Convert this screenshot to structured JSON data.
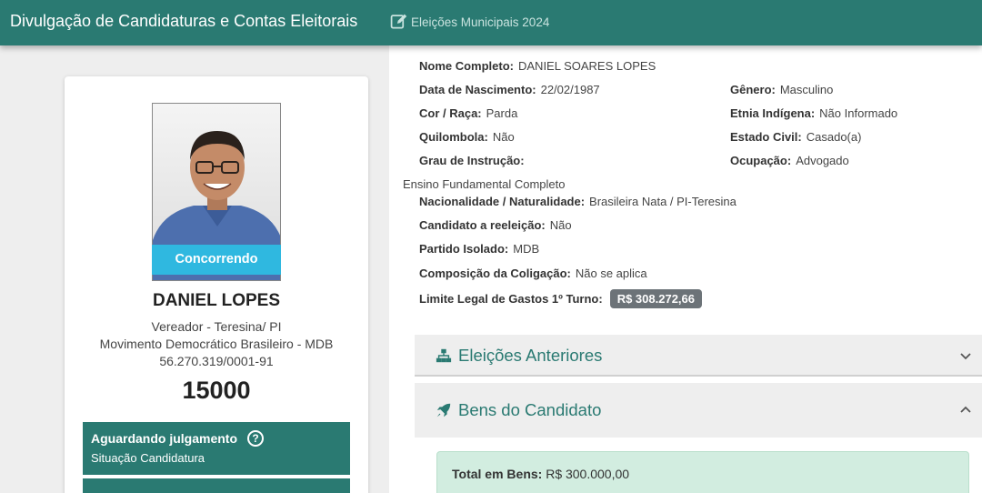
{
  "header": {
    "title": "Divulgação de Candidaturas e Contas Eleitorais",
    "subtitle": "Eleições Municipais 2024",
    "edit_icon": "edit-icon"
  },
  "candidate": {
    "status_badge": "Concorrendo",
    "name": "DANIEL LOPES",
    "office": "Vereador - Teresina/ PI",
    "party_name": "Movimento Democrático Brasileiro - MDB",
    "cnpj": "56.270.319/0001-91",
    "number": "15000",
    "judgment_status": "Aguardando julgamento",
    "judgment_label": "Situação Candidatura",
    "help_icon": "?"
  },
  "details": {
    "full_name_label": "Nome Completo:",
    "full_name": "DANIEL SOARES LOPES",
    "birth_label": "Data de Nascimento:",
    "birth": "22/02/1987",
    "gender_label": "Gênero:",
    "gender": "Masculino",
    "race_label": "Cor / Raça:",
    "race": "Parda",
    "ethnicity_label": "Etnia Indígena:",
    "ethnicity": "Não Informado",
    "quilombola_label": "Quilombola:",
    "quilombola": "Não",
    "marital_label": "Estado Civil:",
    "marital": "Casado(a)",
    "education_label": "Grau de Instrução:",
    "education": "Ensino Fundamental Completo",
    "occupation_label": "Ocupação:",
    "occupation": "Advogado",
    "nationality_label": "Nacionalidade / Naturalidade:",
    "nationality": "Brasileira Nata / PI-Teresina",
    "reelection_label": "Candidato a reeleição:",
    "reelection": "Não",
    "party_label": "Partido Isolado:",
    "party": "MDB",
    "coalition_label": "Composição da Coligação:",
    "coalition": "Não se aplica",
    "spending_label": "Limite Legal de Gastos 1º Turno:",
    "spending": "R$ 308.272,66"
  },
  "sections": {
    "previous_elections": "Eleições Anteriores",
    "assets": "Bens do Candidato",
    "total_assets_label": "Total em Bens:",
    "total_assets": "R$ 300.000,00"
  },
  "colors": {
    "primary": "#2a7a72",
    "badge": "#2fb8e0",
    "money_badge": "#6c7378",
    "success_bg": "#d2ede0"
  }
}
